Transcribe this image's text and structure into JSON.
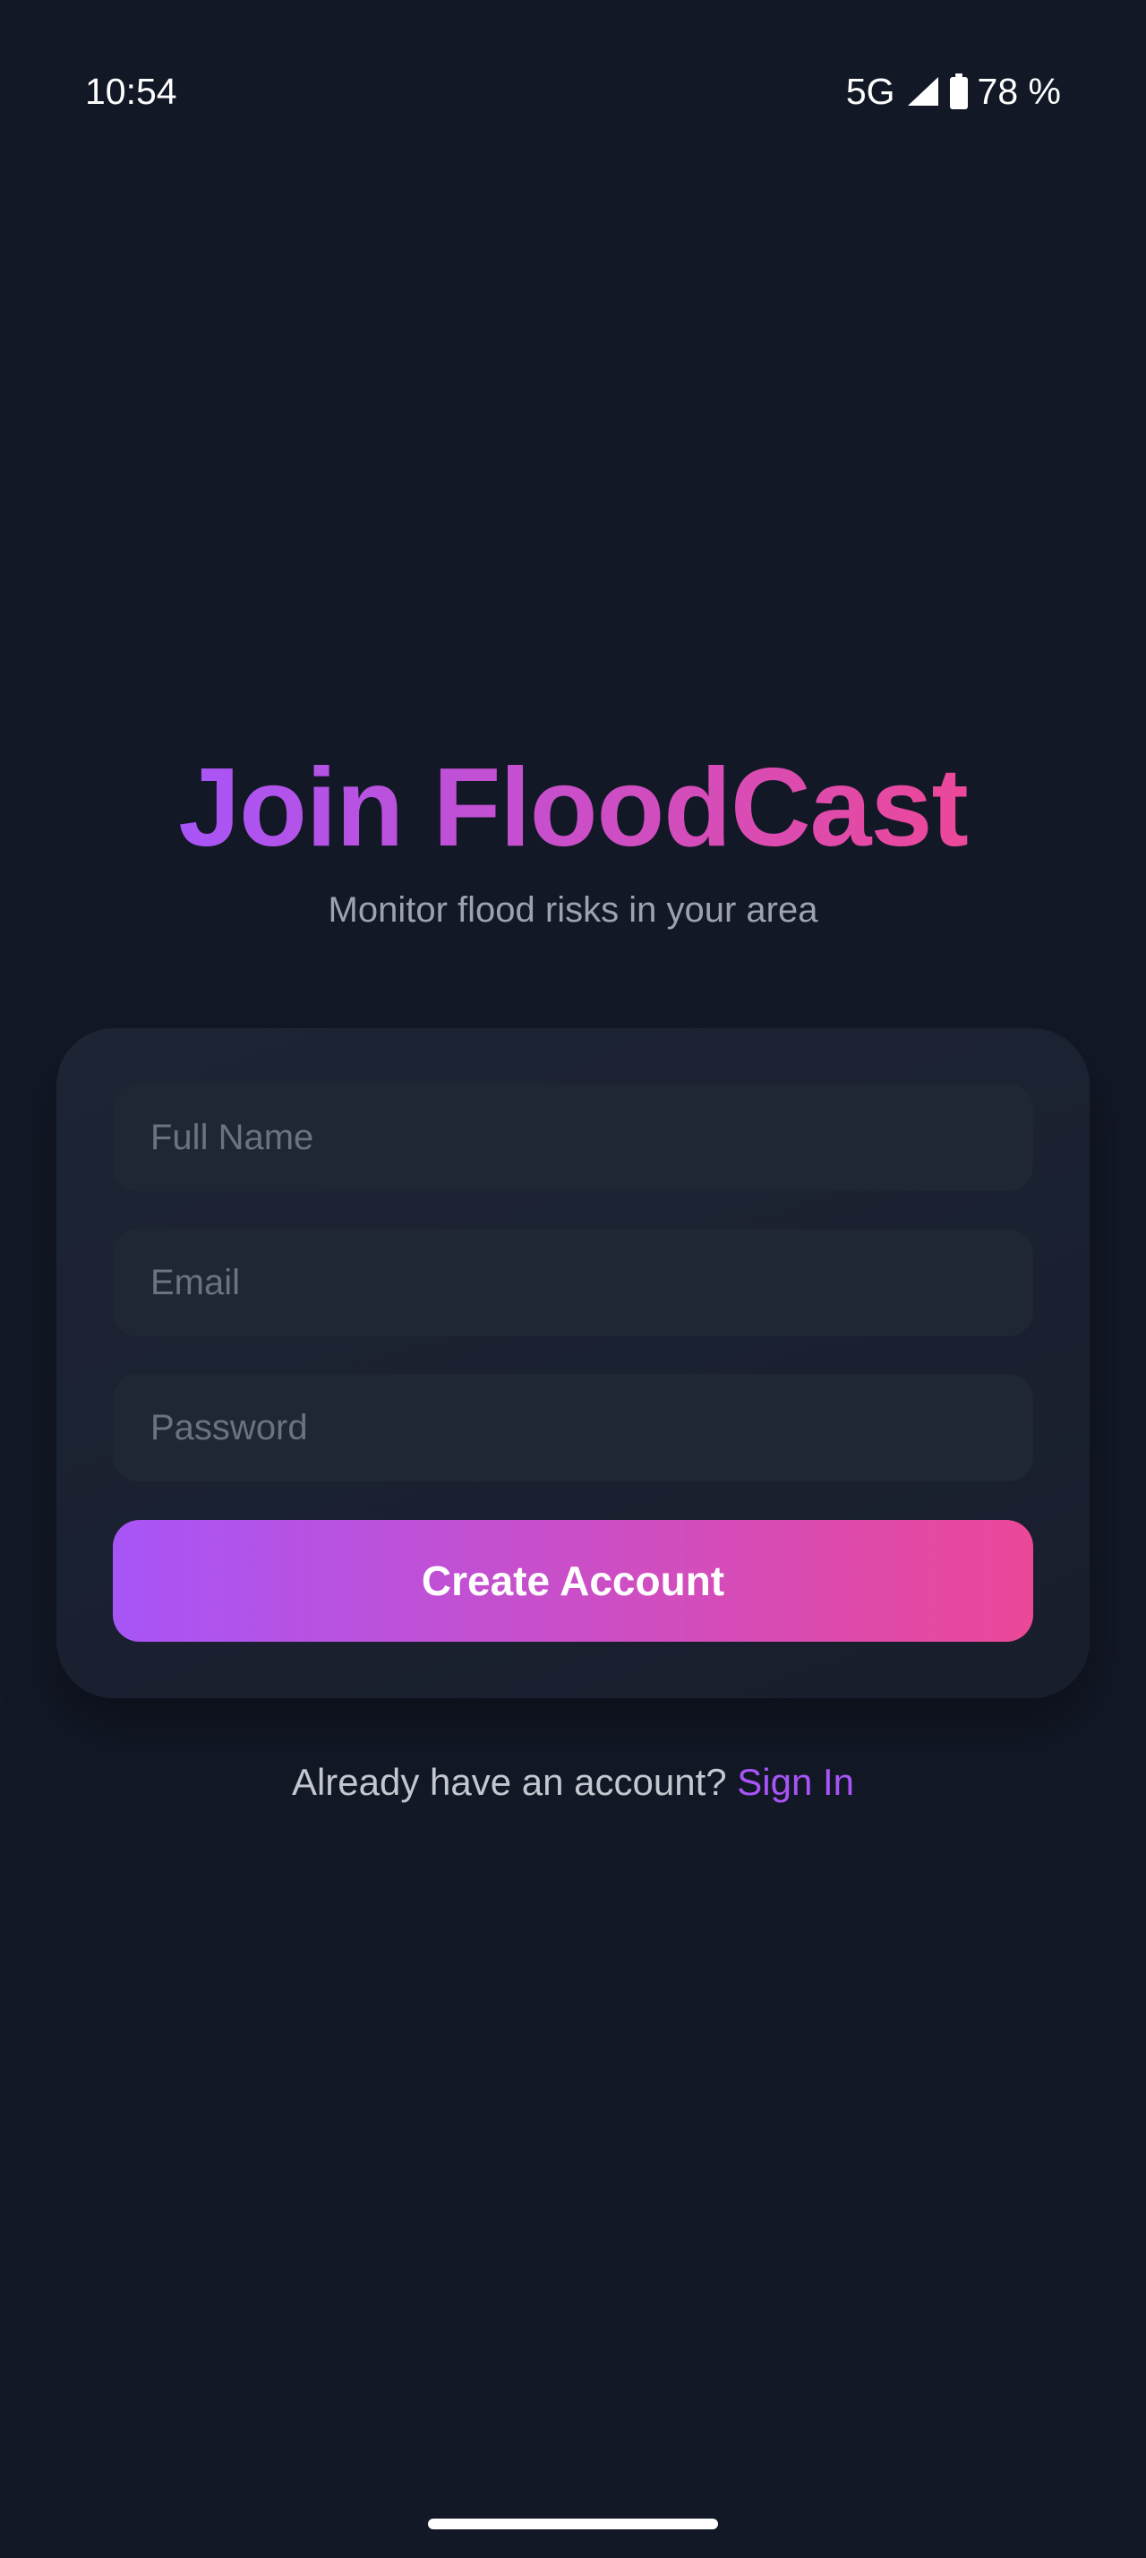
{
  "status_bar": {
    "time": "10:54",
    "network": "5G",
    "battery": "78 %",
    "icons": [
      "signal-icon",
      "battery-icon"
    ]
  },
  "header": {
    "title": "Join FloodCast",
    "subtitle": "Monitor flood risks in your area"
  },
  "form": {
    "full_name": {
      "placeholder": "Full Name",
      "value": ""
    },
    "email": {
      "placeholder": "Email",
      "value": ""
    },
    "password": {
      "placeholder": "Password",
      "value": ""
    },
    "submit_label": "Create Account"
  },
  "footer": {
    "prompt": "Already have an account?",
    "signin_label": "Sign In"
  },
  "colors": {
    "background": "#131827",
    "card": "#1d2434",
    "input": "#1f2735",
    "gradient_start": "#a855f7",
    "gradient_end": "#ec4899",
    "link": "#a855f7"
  }
}
